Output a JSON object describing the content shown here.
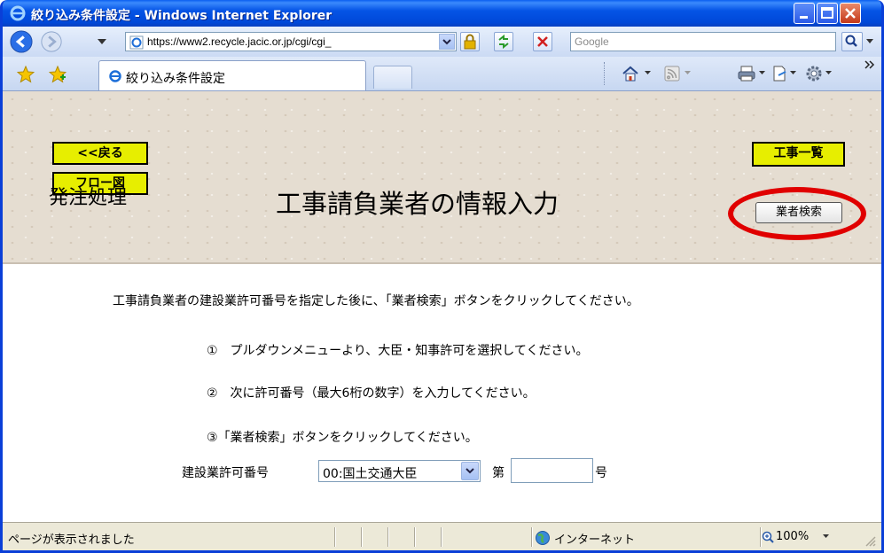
{
  "window": {
    "title": "絞り込み条件設定 - Windows Internet Explorer"
  },
  "address_bar": {
    "url": "https://www2.recycle.jacic.or.jp/cgi/cgi_",
    "search_placeholder": "Google"
  },
  "tab": {
    "label": "絞り込み条件設定"
  },
  "header": {
    "back_label": "<<戻る",
    "flow_label": "フロー図",
    "list_label": "工事一覧",
    "section_label": "発注処理",
    "page_title": "工事請負業者の情報入力",
    "search_button_label": "業者検索"
  },
  "instructions": {
    "intro": "工事請負業者の建設業許可番号を指定した後に、「業者検索」ボタンをクリックしてください。",
    "step1": "①　プルダウンメニューより、大臣・知事許可を選択してください。",
    "step2": "②　次に許可番号（最大6桁の数字）を入力してください。",
    "step3": "③「業者検索」ボタンをクリックしてください。"
  },
  "form": {
    "permit_label": "建設業許可番号",
    "permit_select_value": "00:国土交通大臣",
    "prefix_label": "第",
    "number_value": "",
    "suffix_label": "号"
  },
  "status_bar": {
    "status_text": "ページが表示されました",
    "zone_text": "インターネット",
    "zoom_text": "100%"
  },
  "colors": {
    "title_bar": "#0554e6",
    "yellow_button": "#e7ee00",
    "highlight_oval": "#e00000"
  }
}
